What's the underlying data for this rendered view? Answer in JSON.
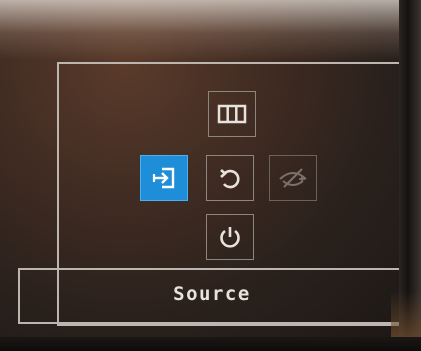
{
  "osd": {
    "footer_label": "Source",
    "selected_item": "source",
    "accent_color": "#1e8ed8",
    "items": [
      {
        "id": "display-layout",
        "icon": "columns-icon",
        "state": "normal"
      },
      {
        "id": "source",
        "icon": "input-source-icon",
        "state": "selected"
      },
      {
        "id": "reset",
        "icon": "rotate-icon",
        "state": "normal"
      },
      {
        "id": "eye-care",
        "icon": "eye-off-icon",
        "state": "disabled"
      },
      {
        "id": "power",
        "icon": "power-icon",
        "state": "normal"
      }
    ]
  }
}
